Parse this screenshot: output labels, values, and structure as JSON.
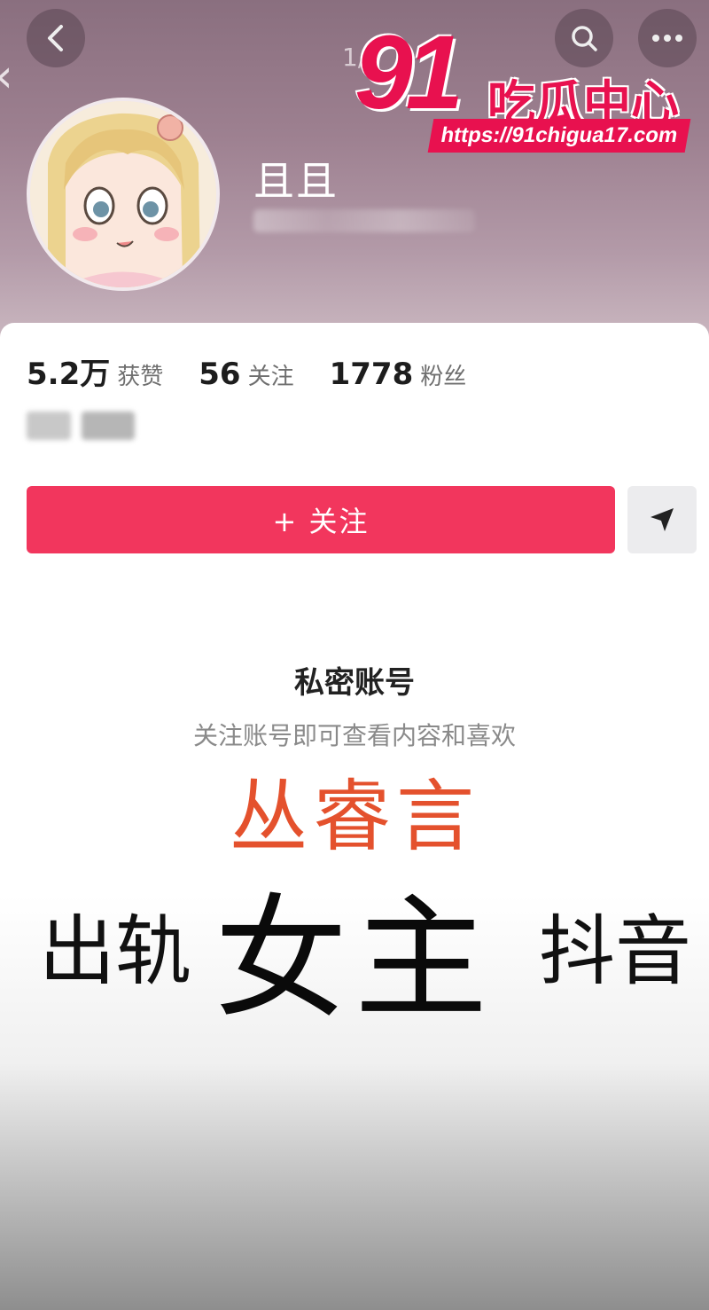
{
  "header": {
    "page_indicator": "1/",
    "back_icon": "chevron-left-icon",
    "search_icon": "search-icon",
    "more_icon": "more-icon"
  },
  "profile": {
    "username": "且且"
  },
  "watermark": {
    "number": "91",
    "text": "吃瓜中心",
    "url": "https://91chigua17.com"
  },
  "stats": [
    {
      "value": "5.2万",
      "label": "获赞"
    },
    {
      "value": "56",
      "label": "关注"
    },
    {
      "value": "1778",
      "label": "粉丝"
    }
  ],
  "actions": {
    "follow_label": "+ 关注",
    "share_icon": "send-icon"
  },
  "private": {
    "title": "私密账号",
    "subtitle": "关注账号即可查看内容和喜欢"
  },
  "overlay": {
    "name": "丛睿言",
    "left": "出轨",
    "middle": "女主",
    "right": "抖音"
  },
  "colors": {
    "follow_button": "#f2365d",
    "watermark": "#e8114f",
    "overlay_name": "#e4512d"
  }
}
